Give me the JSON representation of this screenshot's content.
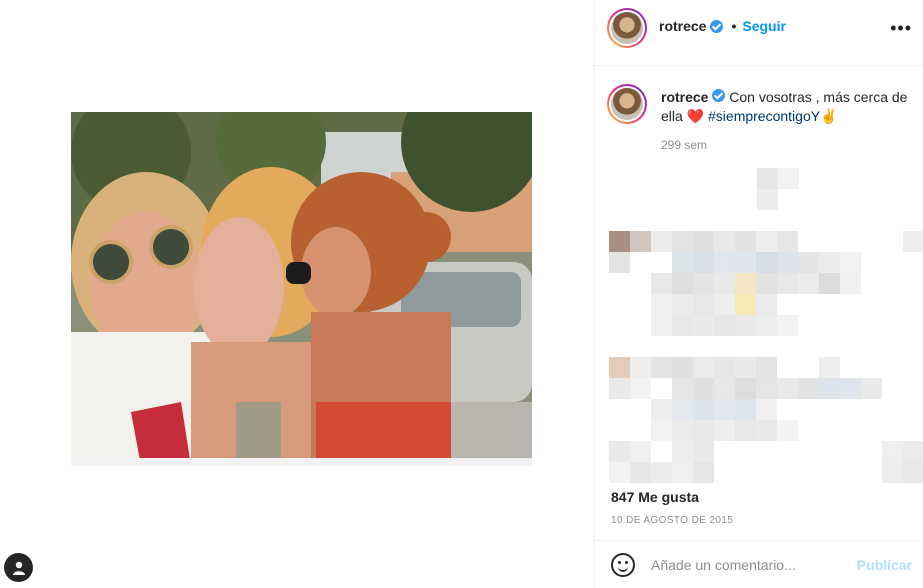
{
  "post": {
    "username": "rotrece",
    "follow_label": "Seguir",
    "separator": "•",
    "more_label": "•••",
    "caption_user": "rotrece",
    "caption_text_1": "Con vosotras , más cerca de ella",
    "caption_heart": "❤️",
    "caption_hashtag": "#siemprecontigoY",
    "caption_emoji": "✌️",
    "caption_time": "299 sem",
    "likes": "847 Me gusta",
    "date": "10 DE AGOSTO DE 2015",
    "comment_placeholder": "Añade un comentario...",
    "publish_label": "Publicar"
  },
  "colors": {
    "accent": "#0095f6",
    "hashtag": "#00376b",
    "muted": "#8e8e8e",
    "publish_disabled": "#b2dffc"
  },
  "icons": {
    "verified": "verified-badge-icon",
    "more": "more-options-icon",
    "emoji": "emoji-icon",
    "user": "user-icon"
  }
}
